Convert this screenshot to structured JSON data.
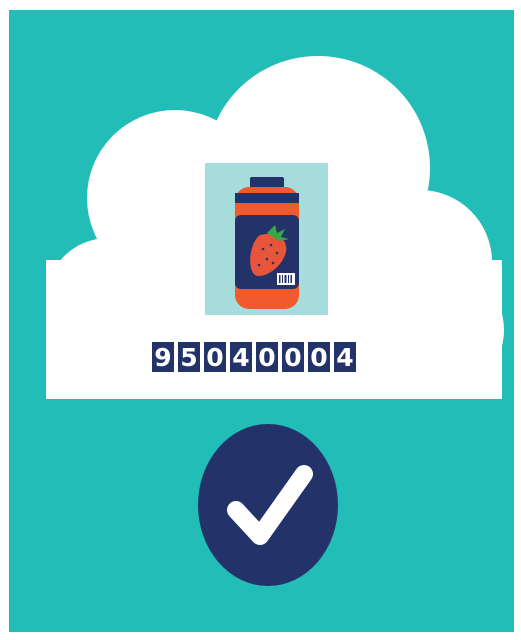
{
  "illustration": {
    "product_code_digits": [
      "9",
      "5",
      "0",
      "4",
      "0",
      "0",
      "0",
      "4"
    ],
    "colors": {
      "background": "#23bdb8",
      "cloud": "#ffffff",
      "tile": "#a6dcdc",
      "jar_body": "#f05a2c",
      "jar_lid": "#233268",
      "label": "#233268",
      "strawberry": "#e8553a",
      "leaves": "#3aa54b",
      "check_circle": "#233268",
      "checkmark": "#ffffff"
    },
    "icons": [
      "cloud-icon",
      "jam-jar-icon",
      "strawberry-icon",
      "barcode-icon",
      "checkmark-icon"
    ]
  }
}
